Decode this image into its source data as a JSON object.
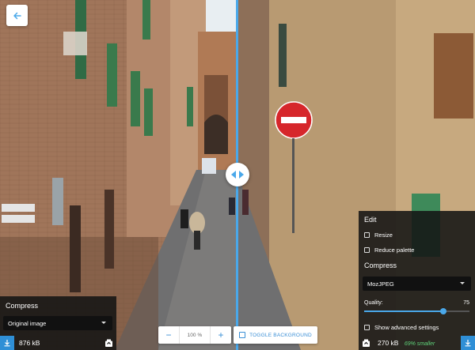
{
  "nav": {
    "back_icon": "arrow-left-icon"
  },
  "divider": {
    "handle_icon": "split-arrows-icon"
  },
  "left_panel": {
    "title": "Compress",
    "method": "Original image",
    "size": "876 kB"
  },
  "right_panel": {
    "edit_title": "Edit",
    "resize_label": "Resize",
    "reduce_palette_label": "Reduce palette",
    "compress_title": "Compress",
    "method": "MozJPEG",
    "quality_label": "Quality:",
    "quality_value": "75",
    "quality_level_percent": 75,
    "advanced_label": "Show advanced settings",
    "size": "270 kB",
    "savings": "69% smaller"
  },
  "zoom": {
    "minus": "−",
    "value": "100",
    "unit": "%",
    "plus": "+"
  },
  "toggle_background": {
    "label": "TOGGLE BACKGROUND"
  },
  "colors": {
    "accent": "#4aa8ea",
    "download_button": "#2f8fd6",
    "savings_text": "#5fd37a",
    "panel_bg": "#141414"
  }
}
